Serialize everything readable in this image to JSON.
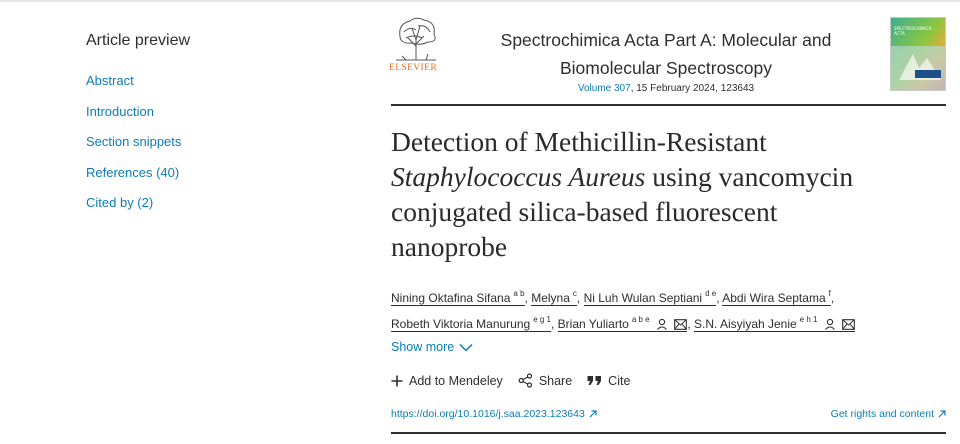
{
  "sidebar": {
    "heading": "Article preview",
    "items": [
      {
        "label": "Abstract"
      },
      {
        "label": "Introduction"
      },
      {
        "label": "Section snippets"
      },
      {
        "label": "References (40)"
      },
      {
        "label": "Cited by (2)"
      }
    ]
  },
  "header": {
    "publisher": "ELSEVIER",
    "journal_line1": "Spectrochimica Acta Part A: Molecular and",
    "journal_line2": "Biomolecular Spectroscopy",
    "volume": "Volume 307",
    "issue_info": ", 15 February 2024, 123643",
    "cover_text_line1": "SPECTROCHIMICA",
    "cover_text_line2": "ACTA"
  },
  "article": {
    "title_line1": "Detection of Methicillin-Resistant",
    "title_italic": "Staphylococcus Aureus",
    "title_line2_rest": " using vancomycin",
    "title_line3": "conjugated silica-based fluorescent",
    "title_line4": "nanoprobe"
  },
  "authors": [
    {
      "name": "Nining Oktafina Sifana",
      "sup": "a b"
    },
    {
      "name": "Melyna",
      "sup": "c"
    },
    {
      "name": "Ni Luh Wulan Septiani",
      "sup": "d e"
    },
    {
      "name": "Abdi Wira Septama",
      "sup": "f"
    },
    {
      "name": "Robeth Viktoria Manurung",
      "sup": "e g 1"
    },
    {
      "name": "Brian Yuliarto",
      "sup": "a b e"
    },
    {
      "name": "S.N. Aisyiyah Jenie",
      "sup": "e h 1"
    }
  ],
  "show_more": "Show more",
  "actions": {
    "mendeley": "Add to Mendeley",
    "share": "Share",
    "cite": "Cite"
  },
  "links": {
    "doi": "https://doi.org/10.1016/j.saa.2023.123643",
    "rights": "Get rights and content"
  },
  "colors": {
    "link": "#0c7db6",
    "elsevier_orange": "#e9711c",
    "text": "#2e2e2e"
  }
}
